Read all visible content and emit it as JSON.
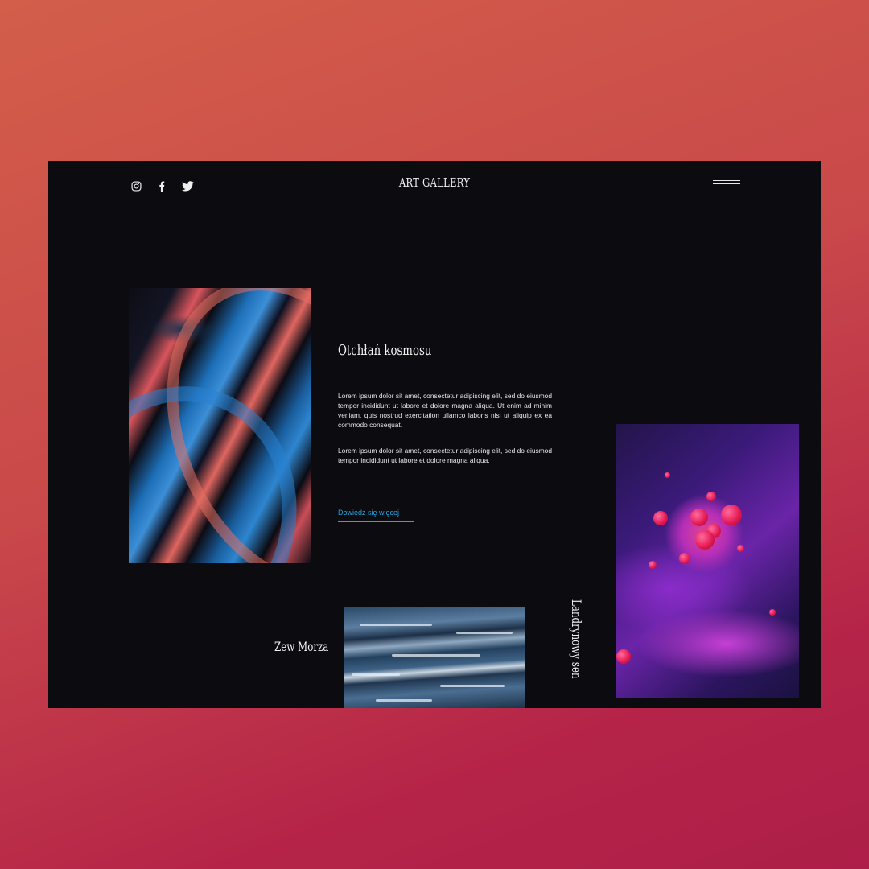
{
  "header": {
    "logo": "ART GALLERY",
    "social_icons": [
      "instagram-icon",
      "facebook-icon",
      "twitter-icon"
    ],
    "menu_icon": "hamburger-menu-icon"
  },
  "feature": {
    "title": "Otchłań kosmosu",
    "paragraph1": "Lorem ipsum dolor sit amet, consectetur adipiscing elit, sed do eiusmod tempor incididunt ut labore et dolore magna aliqua. Ut enim ad minim veniam, quis nostrud exercitation ullamco laboris nisi ut aliquip ex ea commodo consequat.",
    "paragraph2": "Lorem ipsum dolor sit amet, consectetur adipiscing elit, sed do eiusmod tempor incididunt ut labore et dolore magna aliqua.",
    "link_label": "Dowiedz się więcej"
  },
  "gallery": {
    "sea_caption": "Zew Morza",
    "candy_caption": "Landrynowy sen"
  },
  "colors": {
    "background_top": "#d35e4a",
    "background_bottom": "#ad1e48",
    "panel": "#0b0b10",
    "accent": "#1ea8e6",
    "text": "#f2f2f2"
  }
}
